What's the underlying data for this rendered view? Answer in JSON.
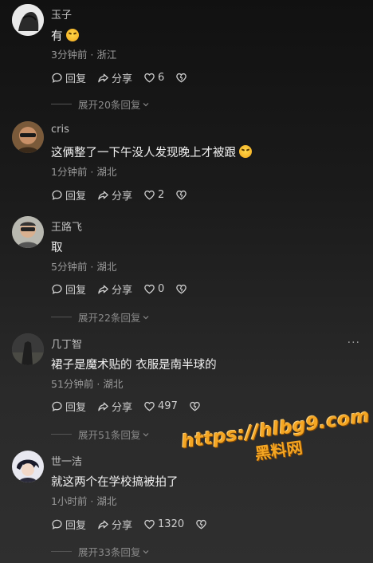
{
  "comments": [
    {
      "user": "玉子",
      "text": "有",
      "meta": "3分钟前 · 浙江",
      "reply_label": "回复",
      "share_label": "分享",
      "likes": "6",
      "expand": "展开20条回复"
    },
    {
      "user": "cris",
      "text": "这俩整了一下午没人发现晚上才被跟",
      "meta": "1分钟前 · 湖北",
      "reply_label": "回复",
      "share_label": "分享",
      "likes": "2"
    },
    {
      "user": "王路飞",
      "text": "取",
      "meta": "5分钟前 · 湖北",
      "reply_label": "回复",
      "share_label": "分享",
      "likes": "0",
      "expand": "展开22条回复"
    },
    {
      "user": "几丁智",
      "text": "裙子是魔术贴的 衣服是南半球的",
      "meta": "51分钟前 · 湖北",
      "reply_label": "回复",
      "share_label": "分享",
      "likes": "497",
      "expand": "展开51条回复",
      "more": "···"
    },
    {
      "user": "世一洁",
      "text": "就这两个在学校搞被拍了",
      "meta": "1小时前 · 湖北",
      "reply_label": "回复",
      "share_label": "分享",
      "likes": "1320",
      "expand": "展开33条回复"
    }
  ],
  "watermark": {
    "url": "https://hlbg9.com",
    "name": "黑料网"
  },
  "colors": {
    "background_top": "#111111",
    "background_bottom": "#2f2f2f",
    "text": "#f2f2f2",
    "meta": "#9a9a9a",
    "watermark": "#f4a623"
  },
  "icons": [
    "comment-bubble-icon",
    "share-arrow-icon",
    "heart-icon",
    "dislike-heart-icon",
    "chevron-down-icon",
    "laugh-cry-emoji-icon"
  ]
}
